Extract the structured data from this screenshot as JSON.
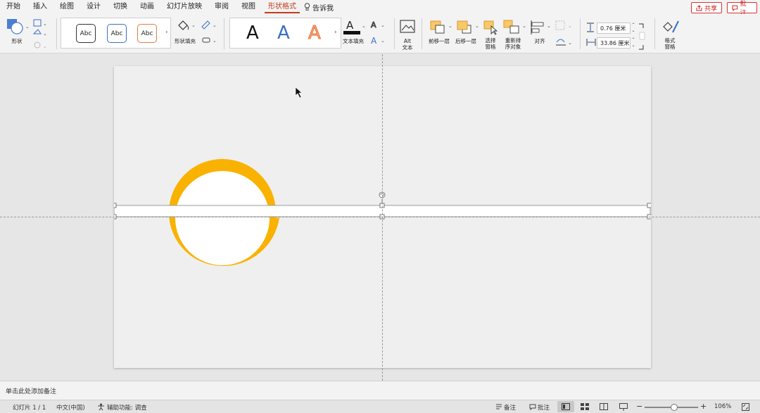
{
  "tabs": [
    "开始",
    "插入",
    "绘图",
    "设计",
    "切换",
    "动画",
    "幻灯片放映",
    "审阅",
    "视图",
    "形状格式"
  ],
  "active_tab_index": 9,
  "tell_me": "告诉我",
  "share_label": "共享",
  "comment_label": "批注",
  "ribbon": {
    "shape_label": "形状",
    "style_abc": [
      "Abc",
      "Abc",
      "Abc"
    ],
    "shape_fill_label": "形状填充",
    "wordart_letter": "A",
    "text_fill_label": "文本填充",
    "alt_text_label": "Alt\n文本",
    "bring_forward_label": "前移一层",
    "send_backward_label": "后移一层",
    "selection_pane_label": "选择\n窗格",
    "reorder_label": "重新排\n序对象",
    "align_label": "对齐",
    "height_value": "0.76 厘米",
    "width_value": "33.86 厘米",
    "format_pane_label": "格式\n窗格",
    "colors": {
      "accent": "#c43b1c",
      "blue": "#3a6fc4",
      "orange": "#e9793d"
    }
  },
  "slide": {
    "shape_colors": {
      "ring": "#f9b200",
      "inner": "#ffffff"
    }
  },
  "notes_placeholder": "单击此处添加备注",
  "status": {
    "slide_indicator": "幻灯片 1 / 1",
    "language": "中文(中国)",
    "accessibility": "辅助功能: 调查",
    "notes_btn": "备注",
    "comments_btn": "批注",
    "zoom_percent": "106%",
    "zoom_level": 0.55
  }
}
